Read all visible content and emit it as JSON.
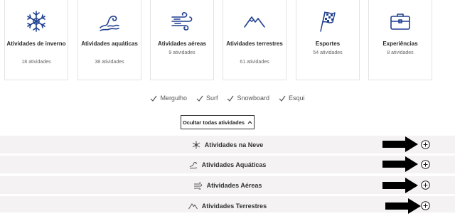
{
  "cards": [
    {
      "title": "Atividades de inverno",
      "count": "18 atividades",
      "icon": "snowflake-icon"
    },
    {
      "title": "Atividades aquáticas",
      "count": "38 atividades",
      "icon": "wave-icon"
    },
    {
      "title": "Atividades aéreas",
      "count": "9 atividades",
      "icon": "wind-icon"
    },
    {
      "title": "Atividades terrestres",
      "count": "61 atividades",
      "icon": "mountain-icon"
    },
    {
      "title": "Esportes",
      "count": "54 atividades",
      "icon": "checkered-flag-icon"
    },
    {
      "title": "Experiências",
      "count": "8 atividades",
      "icon": "briefcase-icon"
    }
  ],
  "chips": [
    "Mergulho",
    "Surf",
    "Snowboard",
    "Esqui"
  ],
  "hide_button": {
    "label": "Ocultar todas atividades"
  },
  "accordions": [
    {
      "label": "Atividades na Neve",
      "icon": "snowflake-icon"
    },
    {
      "label": "Atividades Aquáticas",
      "icon": "wave-icon"
    },
    {
      "label": "Atividades Aéreas",
      "icon": "wind-icon"
    },
    {
      "label": "Atividades Terrestres",
      "icon": "mountain-icon"
    }
  ],
  "colors": {
    "icon_blue": "#1f3f8f",
    "accordion_bg": "#f4f2f2",
    "arrow": "#000000"
  }
}
